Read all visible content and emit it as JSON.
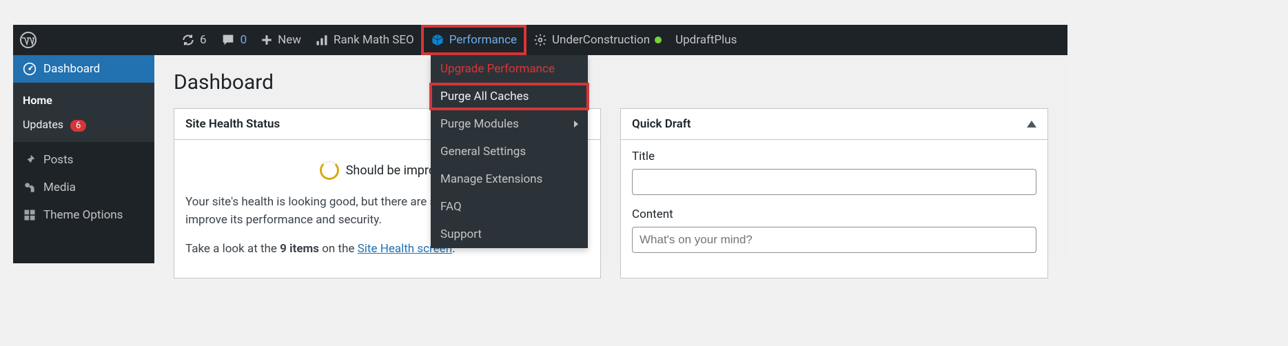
{
  "adminbar": {
    "updates_count": "6",
    "comments_count": "0",
    "new_label": "New",
    "rankmath_label": "Rank Math SEO",
    "performance_label": "Performance",
    "underconstruction_label": "UnderConstruction",
    "updraft_label": "UpdraftPlus"
  },
  "sidebar": {
    "dashboard_label": "Dashboard",
    "home_label": "Home",
    "updates_label": "Updates",
    "updates_count": "6",
    "posts_label": "Posts",
    "media_label": "Media",
    "theme_options_label": "Theme Options"
  },
  "dropdown": {
    "upgrade_label": "Upgrade Performance",
    "purge_all_label": "Purge All Caches",
    "purge_modules_label": "Purge Modules",
    "general_label": "General Settings",
    "extensions_label": "Manage Extensions",
    "faq_label": "FAQ",
    "support_label": "Support"
  },
  "main": {
    "page_title": "Dashboard",
    "site_health": {
      "panel_title": "Site Health Status",
      "status_text": "Should be improved",
      "line1_a": "Your site's health is looking good, but there are still some things you can do to",
      "line1_b": "improve its performance and security.",
      "line2_a": "Take a look at the ",
      "line2_bold": "9 items",
      "line2_b": " on the ",
      "link_text": "Site Health screen",
      "line2_c": "."
    },
    "quick_draft": {
      "panel_title": "Quick Draft",
      "title_label": "Title",
      "content_label": "Content",
      "content_placeholder": "What's on your mind?"
    }
  }
}
